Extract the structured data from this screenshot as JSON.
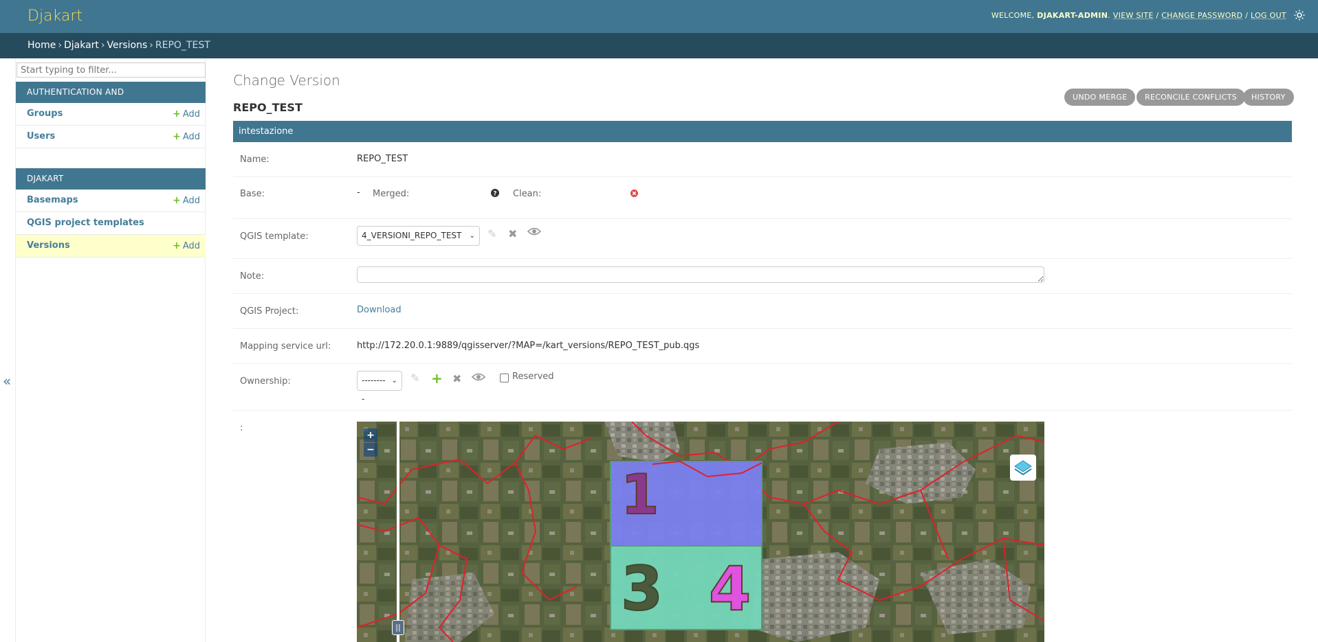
{
  "header": {
    "brand": "Djakart",
    "welcome": "WELCOME,",
    "username": "DJAKART-ADMIN",
    "view_site": "VIEW SITE",
    "change_password": "CHANGE PASSWORD",
    "log_out": "LOG OUT",
    "theme_icon": "sun-icon"
  },
  "breadcrumbs": [
    "Home",
    "Djakart",
    "Versions",
    "REPO_TEST"
  ],
  "sidebar": {
    "filter_placeholder": "Start typing to filter...",
    "modules": [
      {
        "caption": "Authentication and Authorization",
        "models": [
          {
            "name": "Groups",
            "add": "Add"
          },
          {
            "name": "Users",
            "add": "Add"
          }
        ]
      },
      {
        "caption": "Djakart",
        "models": [
          {
            "name": "Basemaps",
            "add": "Add"
          },
          {
            "name": "QGIS project templates",
            "add": ""
          },
          {
            "name": "Versions",
            "add": "Add",
            "current": true
          }
        ]
      }
    ],
    "toggle": "«"
  },
  "content": {
    "title": "Change Version",
    "object_name": "REPO_TEST",
    "tools": [
      "UNDO MERGE",
      "RECONCILE CONFLICTS",
      "HISTORY"
    ],
    "fieldset": "intestazione",
    "fields": {
      "name_label": "Name:",
      "name_value": "REPO_TEST",
      "base_label": "Base:",
      "base_value": "-",
      "merged_label": "Merged:",
      "merged_icon": "question-icon",
      "clean_label": "Clean:",
      "clean_icon": "error-icon",
      "template_label": "QGIS template:",
      "template_value": "4_VERSIONI_REPO_TEST",
      "note_label": "Note:",
      "note_value": "",
      "project_label": "QGIS Project:",
      "project_link": "Download",
      "mapping_label": "Mapping service url:",
      "mapping_value": "http://172.20.0.1:9889/qgisserver/?MAP=/kart_versions/REPO_TEST_pub.qgs",
      "ownership_label": "Ownership:",
      "ownership_value": "---------",
      "reserved_label": "Reserved",
      "map_label": ":"
    },
    "map": {
      "zoom_in": "+",
      "zoom_out": "−",
      "labels": [
        "1",
        "3",
        "4"
      ]
    }
  },
  "colors": {
    "header": "#417690",
    "breadcrumbs": "#264b5d",
    "brand": "#f5dd5d",
    "link": "#447e9b",
    "add_green": "#70bf2b"
  }
}
